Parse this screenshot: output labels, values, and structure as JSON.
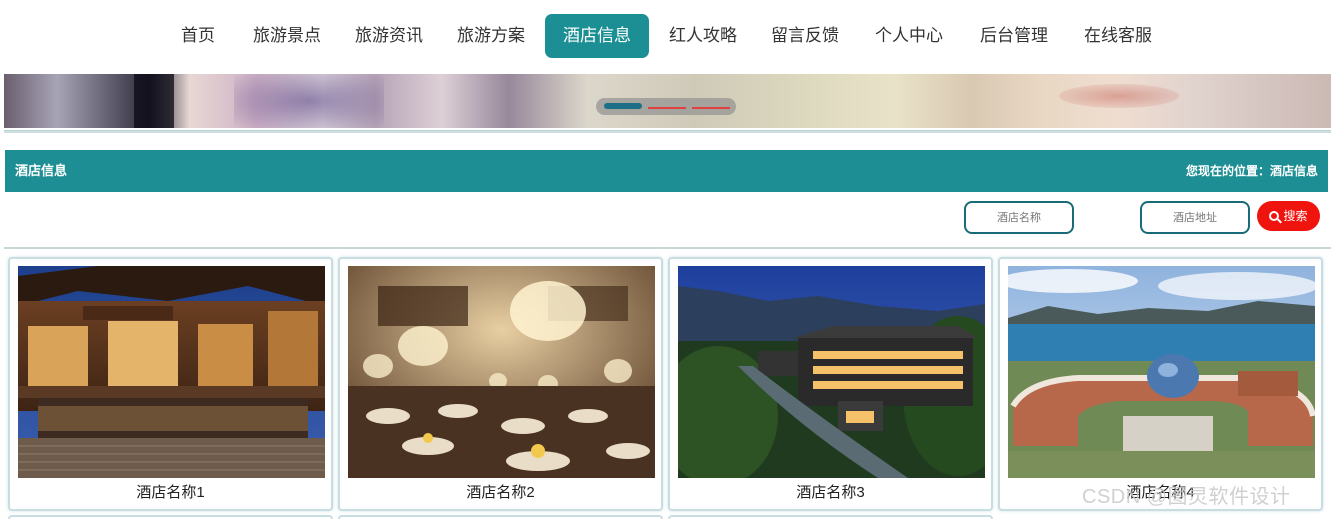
{
  "nav": {
    "items": [
      {
        "label": "首页"
      },
      {
        "label": "旅游景点"
      },
      {
        "label": "旅游资讯"
      },
      {
        "label": "旅游方案"
      },
      {
        "label": "酒店信息",
        "active": true
      },
      {
        "label": "红人攻略"
      },
      {
        "label": "留言反馈"
      },
      {
        "label": "个人中心"
      },
      {
        "label": "后台管理"
      },
      {
        "label": "在线客服"
      }
    ]
  },
  "banner": {
    "slide_count": 3,
    "active_slide": 1
  },
  "section": {
    "title": "酒店信息",
    "breadcrumb": "您现在的位置：酒店信息"
  },
  "search": {
    "name_placeholder": "酒店名称",
    "address_placeholder": "酒店地址",
    "button_label": "搜索",
    "button_icon": "search-icon"
  },
  "hotels": [
    {
      "name": "酒店名称1",
      "image": "traditional-courtyard-photo"
    },
    {
      "name": "酒店名称2",
      "image": "banquet-hall-chandelier-photo"
    },
    {
      "name": "酒店名称3",
      "image": "mountain-resort-night-photo"
    },
    {
      "name": "酒店名称4",
      "image": "seaside-dome-building-photo"
    }
  ],
  "watermark": "CSDN @图灵软件设计",
  "colors": {
    "accent": "#1d8e93",
    "search_button": "#f0140f",
    "input_border": "#1a6b78"
  }
}
